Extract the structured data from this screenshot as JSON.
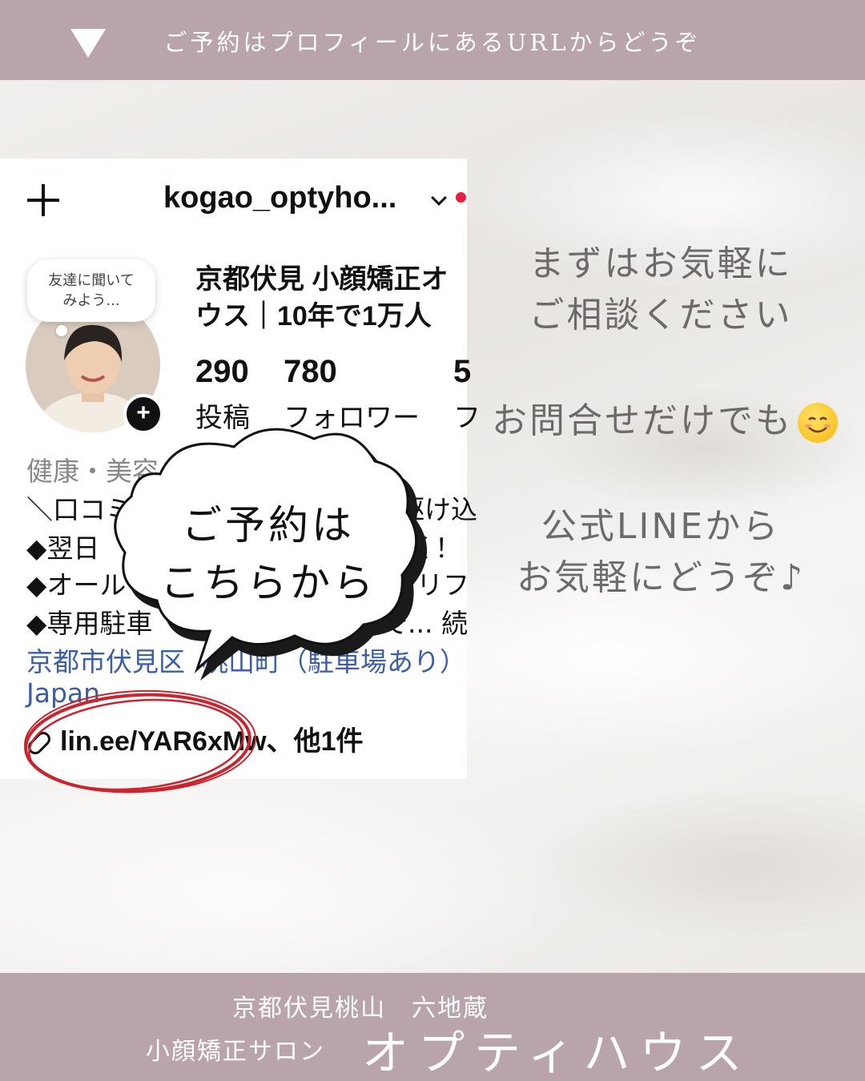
{
  "top_banner": {
    "text": "ご予約はプロフィールにあるURLからどうぞ",
    "icon": "down-triangle-icon",
    "color": "#b9a4ac"
  },
  "profile": {
    "username": "kogao_optyho...",
    "note_bubble": "友達に聞いて\nみよう...",
    "display_name_line1": "京都伏見 小顔矯正オ",
    "display_name_line2": "ウス｜10年で1万人",
    "stats": [
      {
        "value": "290",
        "label": "投稿"
      },
      {
        "value": "780",
        "label": "フォロワー"
      },
      {
        "value": "5",
        "label": "フ"
      }
    ],
    "bio": {
      "category": "健康・美容",
      "line1_start": "＼口コミ",
      "line1_end": "の駆け込",
      "line2_start": "◆翌日",
      "line2_end": "く！",
      "line3_start": "◆オール",
      "line3_end": "リフ",
      "line4_start": "◆専用駐車",
      "line4_end": "で... 続",
      "address_start": "京都市伏見区",
      "address_end": "桃山町（駐車場あり）",
      "country": "Japan"
    },
    "link_text": "lin.ee/YAR6xMw、他1件"
  },
  "callout": {
    "line1": "ご予約は",
    "line2": "こちらから"
  },
  "message": {
    "line1": "まずはお気軽に",
    "line2": "ご相談ください",
    "line3": "お問合せだけでも",
    "line3_icon": "smiling-face-icon",
    "line4": "公式LINEから",
    "line5": "お気軽にどうぞ♪"
  },
  "bottom_banner": {
    "location": "京都伏見桃山　六地蔵",
    "tagline": "小顔矯正サロン",
    "brand": "オプティハウス"
  }
}
